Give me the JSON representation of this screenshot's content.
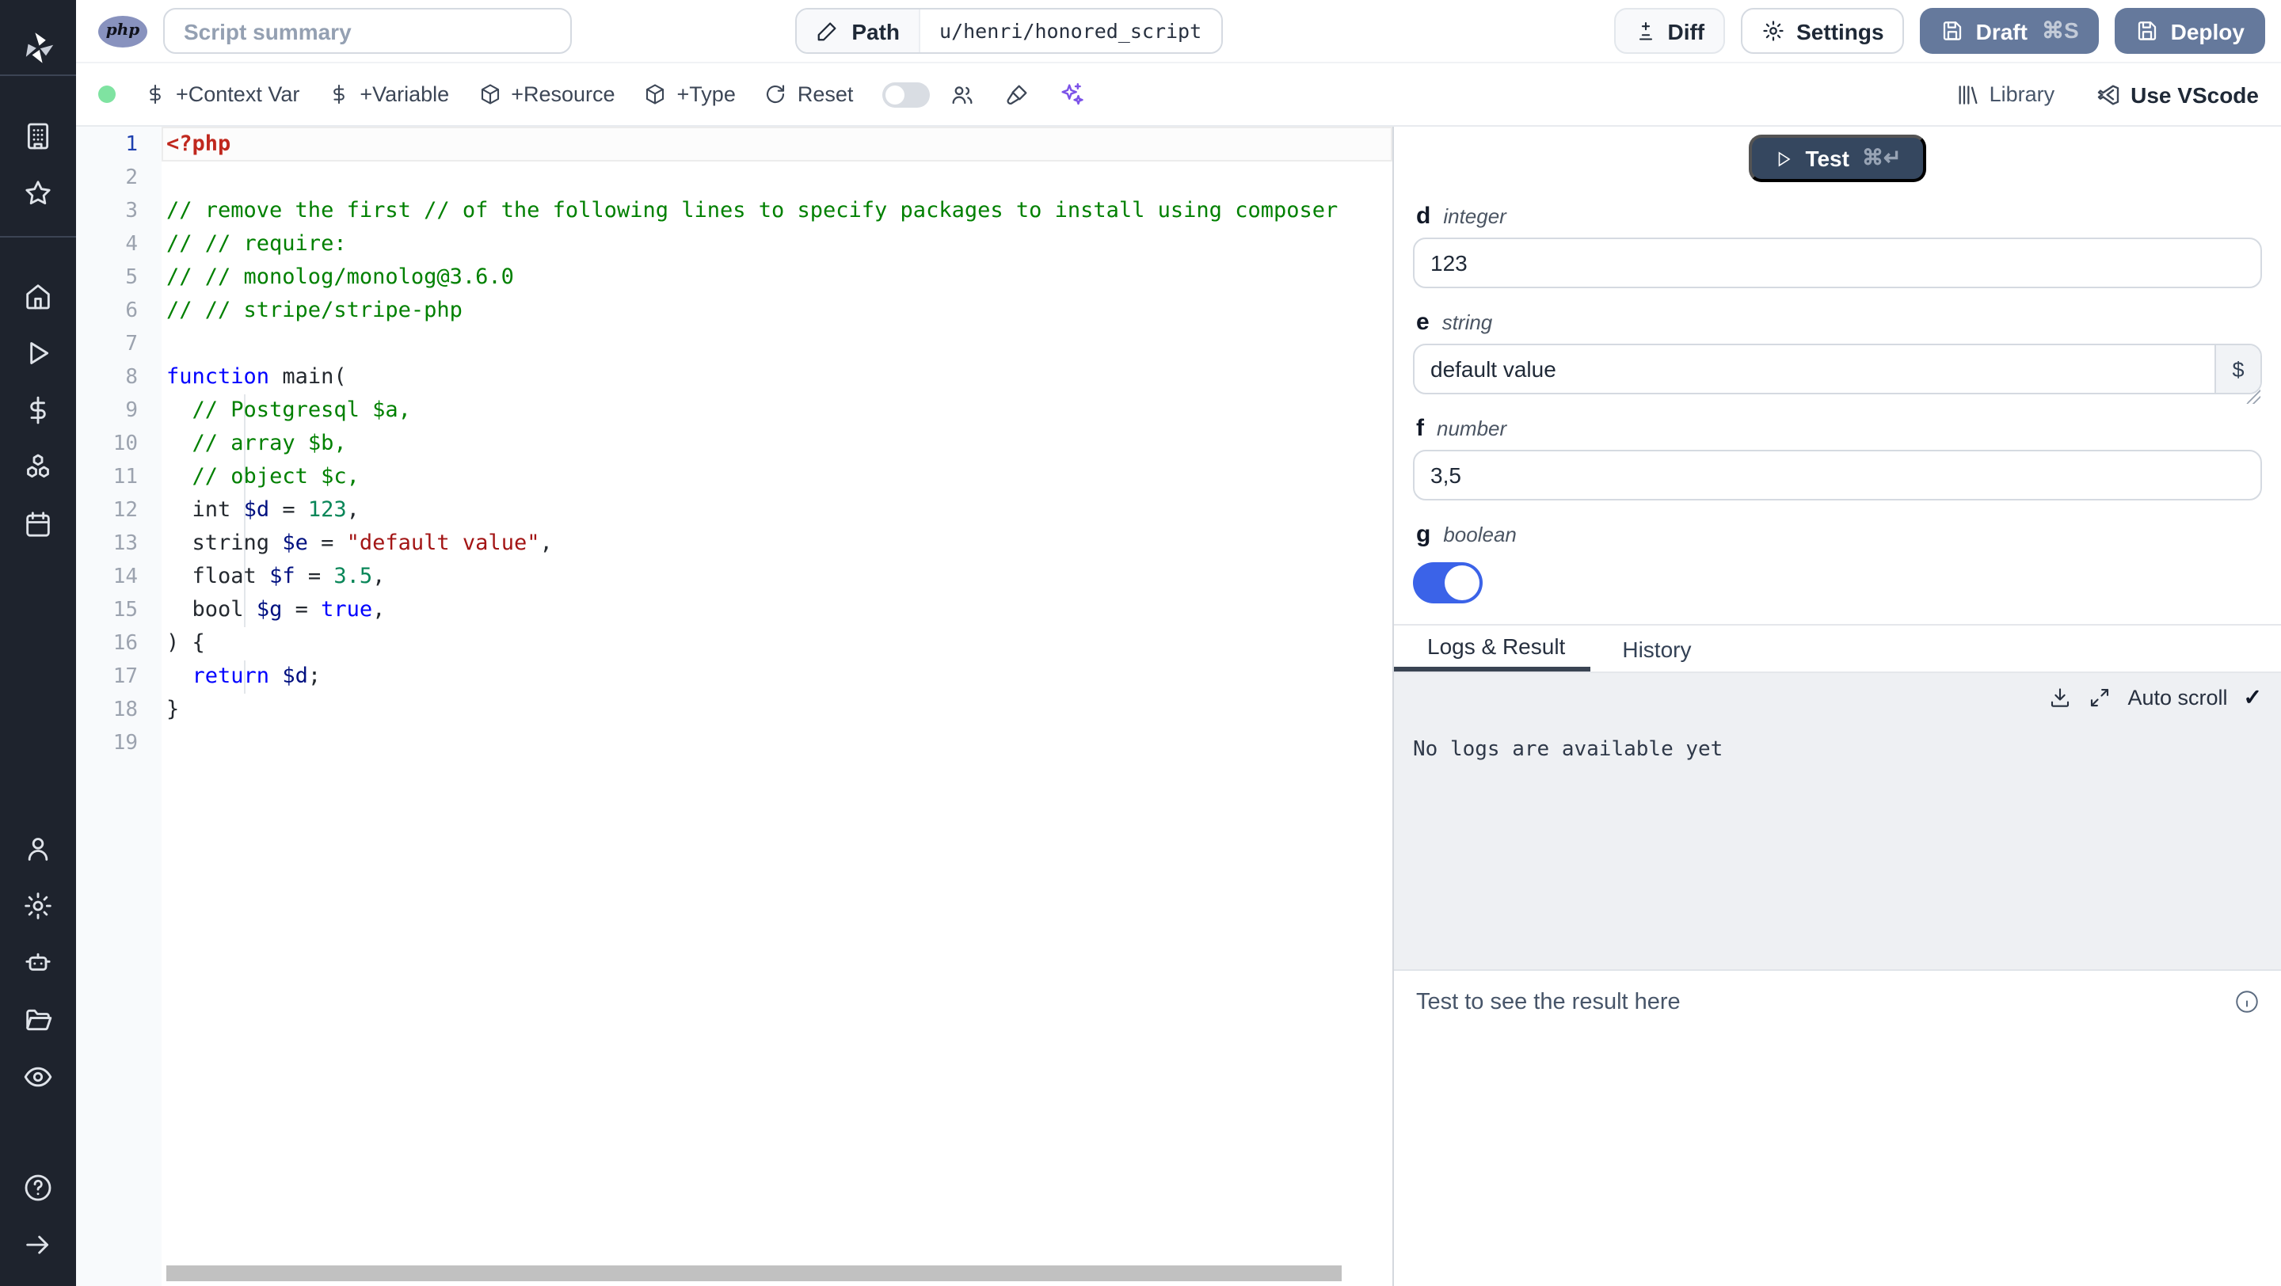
{
  "topbar": {
    "lang_badge": "php",
    "summary_placeholder": "Script summary",
    "path_label": "Path",
    "path_value": "u/henri/honored_script",
    "diff_label": "Diff",
    "settings_label": "Settings",
    "draft_label": "Draft",
    "draft_shortcut": "⌘S",
    "deploy_label": "Deploy"
  },
  "toolbar": {
    "add_context_var": "+Context Var",
    "add_variable": "+Variable",
    "add_resource": "+Resource",
    "add_type": "+Type",
    "reset_label": "Reset",
    "library_label": "Library",
    "use_vscode_label": "Use VScode"
  },
  "sidebar_icons": [
    "building-icon",
    "star-icon",
    "home-icon",
    "play-icon",
    "dollar-icon",
    "boxes-icon",
    "calendar-icon",
    "user-icon",
    "gear-icon",
    "bot-icon",
    "folder-icon",
    "eye-icon",
    "help-circle-icon",
    "arrow-right-icon"
  ],
  "editor": {
    "language": "php",
    "lines": [
      {
        "tokens": [
          [
            "tag",
            "<?php"
          ]
        ]
      },
      {
        "tokens": []
      },
      {
        "tokens": [
          [
            "com",
            "// remove the first // of the following lines to specify packages to install using composer"
          ]
        ]
      },
      {
        "tokens": [
          [
            "com",
            "// // require:"
          ]
        ]
      },
      {
        "tokens": [
          [
            "com",
            "// // monolog/monolog@3.6.0"
          ]
        ]
      },
      {
        "tokens": [
          [
            "com",
            "// // stripe/stripe-php"
          ]
        ]
      },
      {
        "tokens": []
      },
      {
        "tokens": [
          [
            "kw",
            "function"
          ],
          [
            "pl",
            " main("
          ]
        ]
      },
      {
        "tokens": [
          [
            "pl",
            "  "
          ],
          [
            "com",
            "// Postgresql $a,"
          ]
        ]
      },
      {
        "tokens": [
          [
            "pl",
            "  "
          ],
          [
            "com",
            "// array $b,"
          ]
        ]
      },
      {
        "tokens": [
          [
            "pl",
            "  "
          ],
          [
            "com",
            "// object $c,"
          ]
        ]
      },
      {
        "tokens": [
          [
            "pl",
            "  int "
          ],
          [
            "var",
            "$d"
          ],
          [
            "pl",
            " = "
          ],
          [
            "num",
            "123"
          ],
          [
            "pl",
            ","
          ]
        ]
      },
      {
        "tokens": [
          [
            "pl",
            "  string "
          ],
          [
            "var",
            "$e"
          ],
          [
            "pl",
            " = "
          ],
          [
            "str",
            "\"default value\""
          ],
          [
            "pl",
            ","
          ]
        ]
      },
      {
        "tokens": [
          [
            "pl",
            "  float "
          ],
          [
            "var",
            "$f"
          ],
          [
            "pl",
            " = "
          ],
          [
            "num",
            "3.5"
          ],
          [
            "pl",
            ","
          ]
        ]
      },
      {
        "tokens": [
          [
            "pl",
            "  bool "
          ],
          [
            "var",
            "$g"
          ],
          [
            "pl",
            " = "
          ],
          [
            "kw",
            "true"
          ],
          [
            "pl",
            ","
          ]
        ]
      },
      {
        "tokens": [
          [
            "pl",
            ") {"
          ]
        ]
      },
      {
        "tokens": [
          [
            "pl",
            "  "
          ],
          [
            "kw",
            "return"
          ],
          [
            "pl",
            " "
          ],
          [
            "var",
            "$d"
          ],
          [
            "pl",
            ";"
          ]
        ]
      },
      {
        "tokens": [
          [
            "pl",
            "}"
          ]
        ]
      },
      {
        "tokens": []
      }
    ]
  },
  "panel": {
    "test_label": "Test",
    "test_shortcut": "⌘↵",
    "fields": [
      {
        "name": "d",
        "type": "integer",
        "value": "123"
      },
      {
        "name": "e",
        "type": "string",
        "value": "default value",
        "suffix": "$"
      },
      {
        "name": "f",
        "type": "number",
        "value": "3,5"
      },
      {
        "name": "g",
        "type": "boolean",
        "value": true
      }
    ],
    "tabs": [
      {
        "label": "Logs & Result"
      },
      {
        "label": "History"
      }
    ],
    "autoscroll_label": "Auto scroll",
    "checkmark": "✓",
    "no_logs_text": "No logs are available yet",
    "result_placeholder": "Test to see the result here"
  },
  "colors": {
    "sidebar_bg": "#1e232d",
    "slate_button": "#65799c",
    "test_button": "#35475f",
    "toggle_on": "#3b63e8",
    "sparkle": "#7c52e8",
    "php_badge": "#8892be",
    "status_dot_green": "#7fe3a1",
    "logs_bg": "#eef0f3",
    "comment_green": "#008000",
    "keyword_blue": "#0000ff",
    "string_red": "#a31515",
    "number_green": "#098658"
  }
}
